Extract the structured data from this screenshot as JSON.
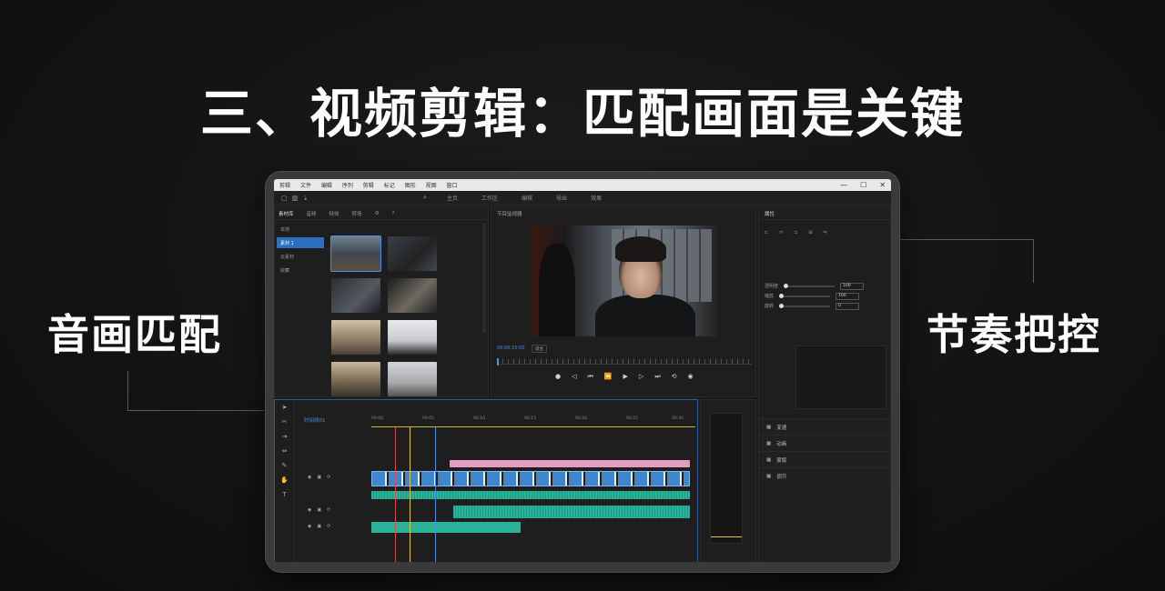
{
  "headline": "三、视频剪辑：匹配画面是关键",
  "labels": {
    "left": "音画匹配",
    "right": "节奏把控"
  },
  "editor": {
    "menu": [
      "剪辑",
      "文件",
      "编辑",
      "序列",
      "剪辑",
      "标记",
      "图形",
      "视图",
      "窗口"
    ],
    "window_controls": [
      "—",
      "☐",
      "✕"
    ],
    "toolbar_tabs": [
      "主页",
      "工作区",
      "编辑",
      "导出",
      "效果"
    ],
    "media_tabs": [
      "素材库",
      "音频",
      "特效",
      "转场"
    ],
    "media_side": [
      "本地",
      "素材 1",
      "云素材",
      "收藏"
    ],
    "preview_title": "节目监视器",
    "preview_timecode": "00:00:15:00",
    "preview_chip": "适合",
    "props_title": "属性",
    "props_rows": [
      {
        "label": "透明度",
        "value": "100"
      },
      {
        "label": "缩放",
        "value": "100"
      },
      {
        "label": "旋转",
        "value": "0"
      }
    ],
    "props_list": [
      "变速",
      "动画",
      "蒙版",
      "调节"
    ],
    "timeline_name": "时间线01",
    "timeline_ruler": [
      "00:00",
      "00:05",
      "00:10",
      "00:15",
      "00:20",
      "00:25",
      "00:30"
    ]
  }
}
